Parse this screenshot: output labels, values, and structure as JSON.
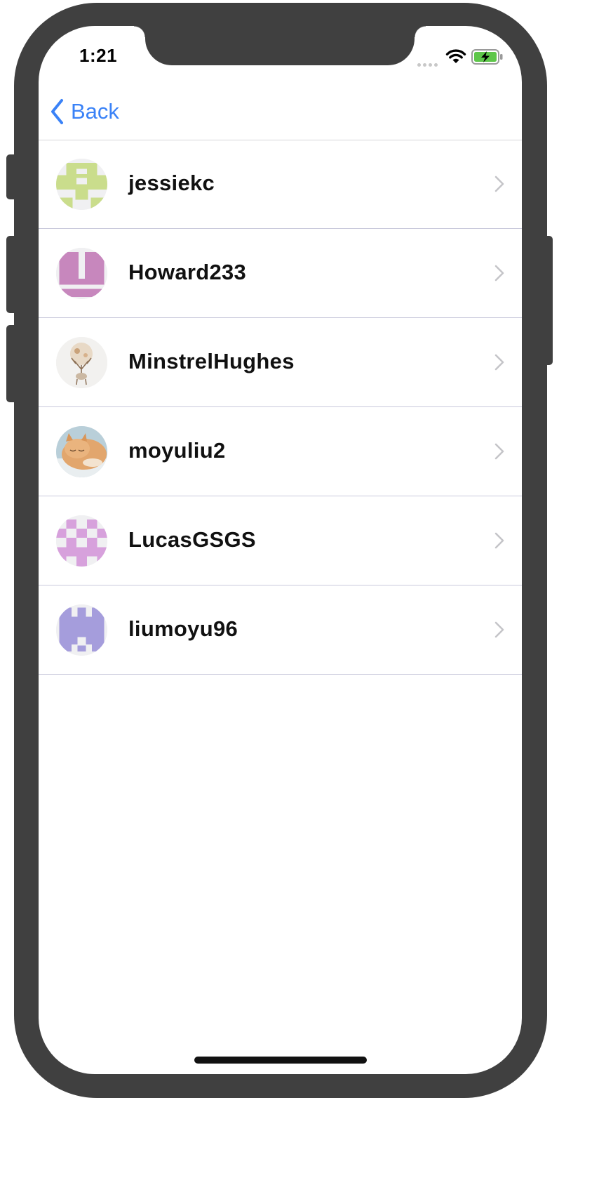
{
  "status_bar": {
    "time": "1:21",
    "icons": [
      "signal-dots-icon",
      "wifi-icon",
      "battery-charging-icon"
    ],
    "battery_color": "#5ec64a"
  },
  "nav": {
    "back_label": "Back",
    "back_icon": "chevron-left-icon",
    "accent_color": "#3a82f7"
  },
  "users": [
    {
      "name": "jessiekc",
      "avatar": "identicon-lime"
    },
    {
      "name": "Howard233",
      "avatar": "identicon-mauve"
    },
    {
      "name": "MinstrelHughes",
      "avatar": "deer-illustration"
    },
    {
      "name": "moyuliu2",
      "avatar": "sleeping-cat-photo"
    },
    {
      "name": "LucasGSGS",
      "avatar": "identicon-pink-checker"
    },
    {
      "name": "liumoyu96",
      "avatar": "identicon-lavender"
    }
  ]
}
